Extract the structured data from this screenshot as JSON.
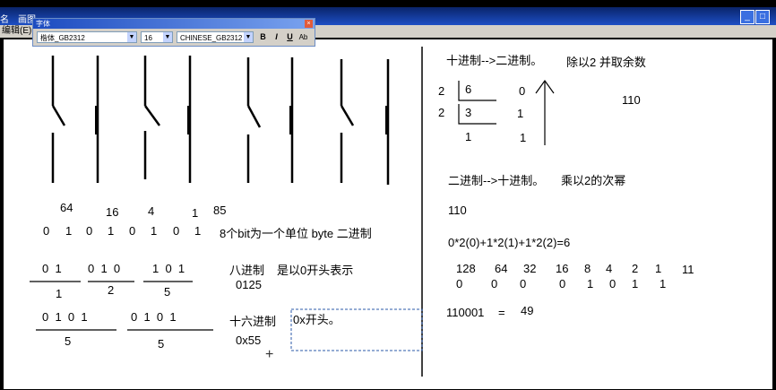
{
  "window": {
    "menu": [
      "名",
      "画图"
    ],
    "submenu": "编辑(E)",
    "controls": [
      "_",
      "□"
    ]
  },
  "font_toolbar": {
    "title": "字体",
    "font_name": "楷体_GB2312",
    "font_size": "16",
    "charset": "CHINESE_GB2312",
    "buttons": [
      "B",
      "I",
      "U",
      "Ab"
    ]
  },
  "switches": {
    "labels": [
      "64",
      "16",
      "4",
      "1",
      "85"
    ]
  },
  "bits_row": {
    "bits": [
      "0",
      "1",
      "0",
      "1",
      "0",
      "1",
      "0",
      "1"
    ],
    "note": "8个bit为一个单位  byte  二进制"
  },
  "groups_row1": {
    "g1": {
      "bits": "0  1",
      "value": "1"
    },
    "g2": {
      "bits": "0  1  0",
      "value": "2"
    },
    "g3": {
      "bits": "1  0  1",
      "value": "5"
    }
  },
  "octal": {
    "label": "八进制",
    "desc": "是以0开头表示",
    "example": "0125"
  },
  "groups_row2": {
    "g1": {
      "bits": "0  1  0  1",
      "value": "5"
    },
    "g2": {
      "bits": "0  1  0  1",
      "value": "5"
    }
  },
  "hex": {
    "label": "十六进制",
    "example": "0x55",
    "textbox": "0x开头。"
  },
  "dec2bin": {
    "title": "十进制-->二进制。",
    "rule": "除以2 并取余数",
    "rows": [
      {
        "divisor": "2",
        "quotient": "6",
        "remainder": "0"
      },
      {
        "divisor": "2",
        "quotient": "3",
        "remainder": "1"
      },
      {
        "divisor": "",
        "quotient": "1",
        "remainder": "1"
      }
    ],
    "result": "110"
  },
  "bin2dec": {
    "title": "二进制-->十进制。",
    "rule": "乘以2的次幂",
    "example": "110",
    "formula": "0*2(0)+1*2(1)+1*2(2)=6"
  },
  "weights": {
    "powers": [
      "128",
      "64",
      "32",
      "16",
      "8",
      "4",
      "2",
      "1"
    ],
    "bits": [
      "0",
      "0",
      "0",
      "0",
      "1",
      "0",
      "1",
      "1"
    ],
    "sum": "11"
  },
  "convert": {
    "binary": "110001",
    "equals": "=",
    "decimal": "49"
  }
}
